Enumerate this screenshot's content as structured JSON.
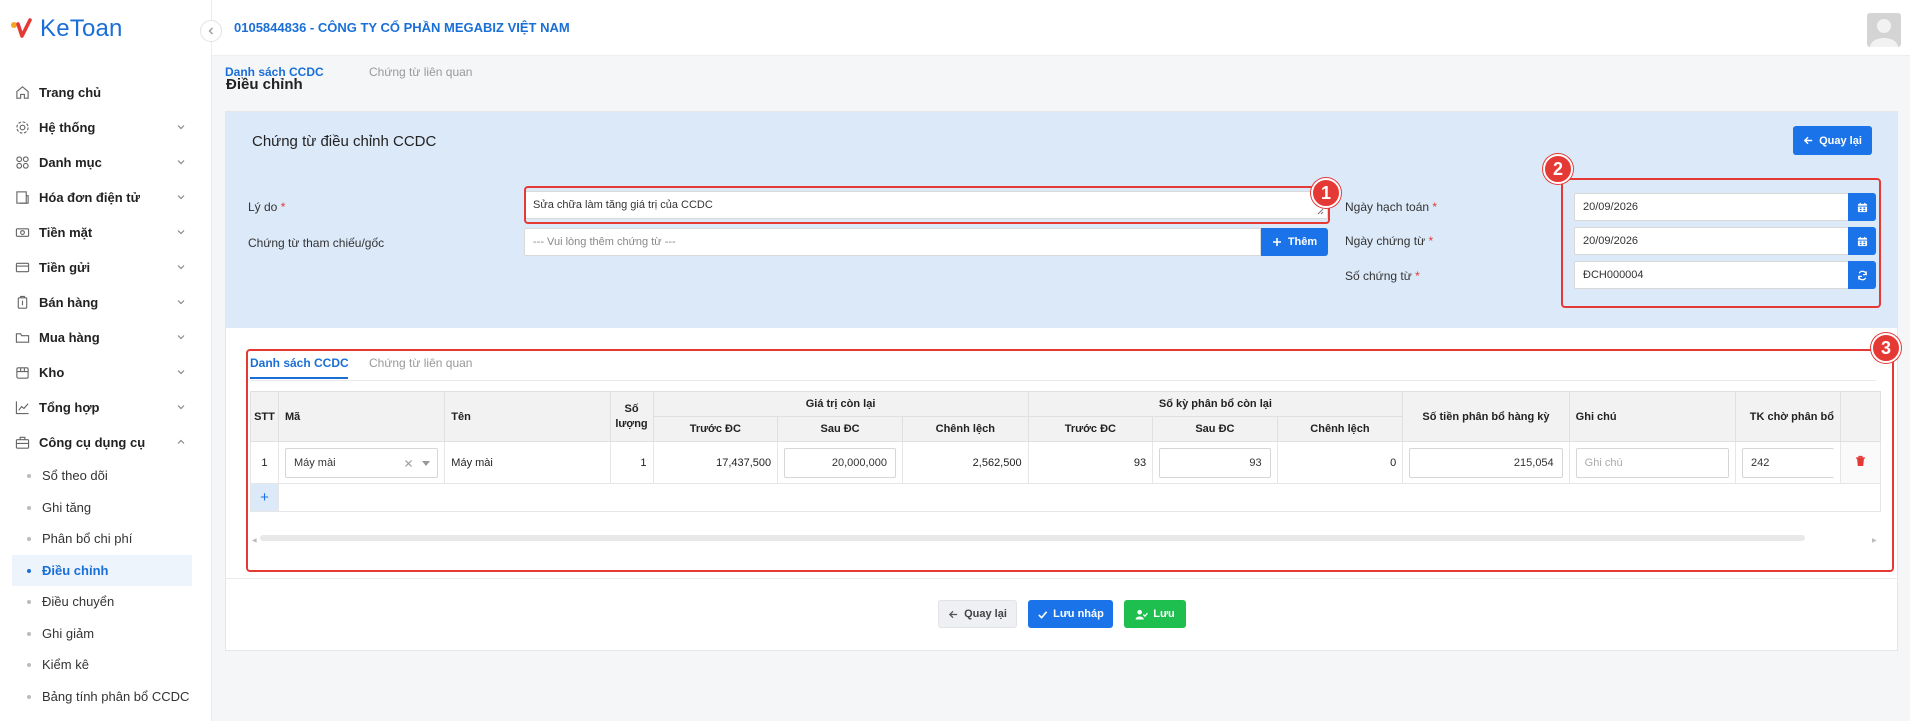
{
  "app": {
    "logo_text": "KeToan"
  },
  "header": {
    "company": "0105844836 - CÔNG TY CỔ PHẦN MEGABIZ VIỆT NAM"
  },
  "sidebar": {
    "items": [
      {
        "label": "Trang chủ",
        "icon": "home-icon"
      },
      {
        "label": "Hệ thống",
        "icon": "gear-icon"
      },
      {
        "label": "Danh mục",
        "icon": "grid-icon"
      },
      {
        "label": "Hóa đơn điện tử",
        "icon": "invoice-icon"
      },
      {
        "label": "Tiền mặt",
        "icon": "cash-icon"
      },
      {
        "label": "Tiền gửi",
        "icon": "card-icon"
      },
      {
        "label": "Bán hàng",
        "icon": "sale-icon"
      },
      {
        "label": "Mua hàng",
        "icon": "cart-icon"
      },
      {
        "label": "Kho",
        "icon": "warehouse-icon"
      },
      {
        "label": "Tổng hợp",
        "icon": "chart-icon"
      },
      {
        "label": "Công cụ dụng cụ",
        "icon": "tools-icon"
      }
    ],
    "subitems": [
      "Sổ theo dõi",
      "Ghi tăng",
      "Phân bổ chi phí",
      "Điều chỉnh",
      "Điều chuyển",
      "Ghi giảm",
      "Kiểm kê",
      "Bảng tính phân bổ CCDC"
    ],
    "active_subitem": "Điều chỉnh"
  },
  "page": {
    "title": "Điều chỉnh"
  },
  "form": {
    "title": "Chứng từ điều chỉnh CCDC",
    "back_top": "Quay lại",
    "reason_label": "Lý do",
    "reason_value": "Sửa chữa làm tăng giá trị của CCDC",
    "ref_label": "Chứng từ tham chiếu/gốc",
    "ref_placeholder": "--- Vui lòng thêm chứng từ ---",
    "add_label": "Thêm",
    "post_date_label": "Ngày hạch toán",
    "post_date": "20/09/2026",
    "doc_date_label": "Ngày chứng từ",
    "doc_date": "20/09/2026",
    "doc_no_label": "Số chứng từ",
    "doc_no": "ĐCH000004",
    "required_mark": "*"
  },
  "annotations": [
    "1",
    "2",
    "3"
  ],
  "tabs": [
    "Danh sách CCDC",
    "Chứng từ liên quan"
  ],
  "table": {
    "group_headers": {
      "remaining_value": "Giá trị còn lại",
      "remaining_periods": "Số kỳ phân bổ còn lại"
    },
    "headers": {
      "stt": "STT",
      "code": "Mã",
      "name": "Tên",
      "qty": "Số lượng",
      "before": "Trước ĐC",
      "after": "Sau ĐC",
      "diff": "Chênh lệch",
      "period_before": "Trước ĐC",
      "period_after": "Sau ĐC",
      "period_diff": "Chênh lệch",
      "alloc": "Số tiền phân bổ hàng kỳ",
      "note": "Ghi chú",
      "account": "TK chờ phân bổ"
    },
    "row": {
      "stt": "1",
      "code": "Máy mài",
      "name": "Máy mài",
      "qty": "1",
      "before": "17,437,500",
      "after": "20,000,000",
      "diff": "2,562,500",
      "period_before": "93",
      "period_after": "93",
      "period_diff": "0",
      "alloc": "215,054",
      "note_placeholder": "Ghi chú",
      "account": "242"
    },
    "add_row": "+"
  },
  "footer": {
    "back": "Quay lại",
    "draft": "Lưu nháp",
    "save": "Lưu"
  },
  "colors": {
    "primary": "#1a73e8",
    "success": "#1fbf4f",
    "annotation": "#e53935",
    "head_bg": "#dce9f9"
  }
}
